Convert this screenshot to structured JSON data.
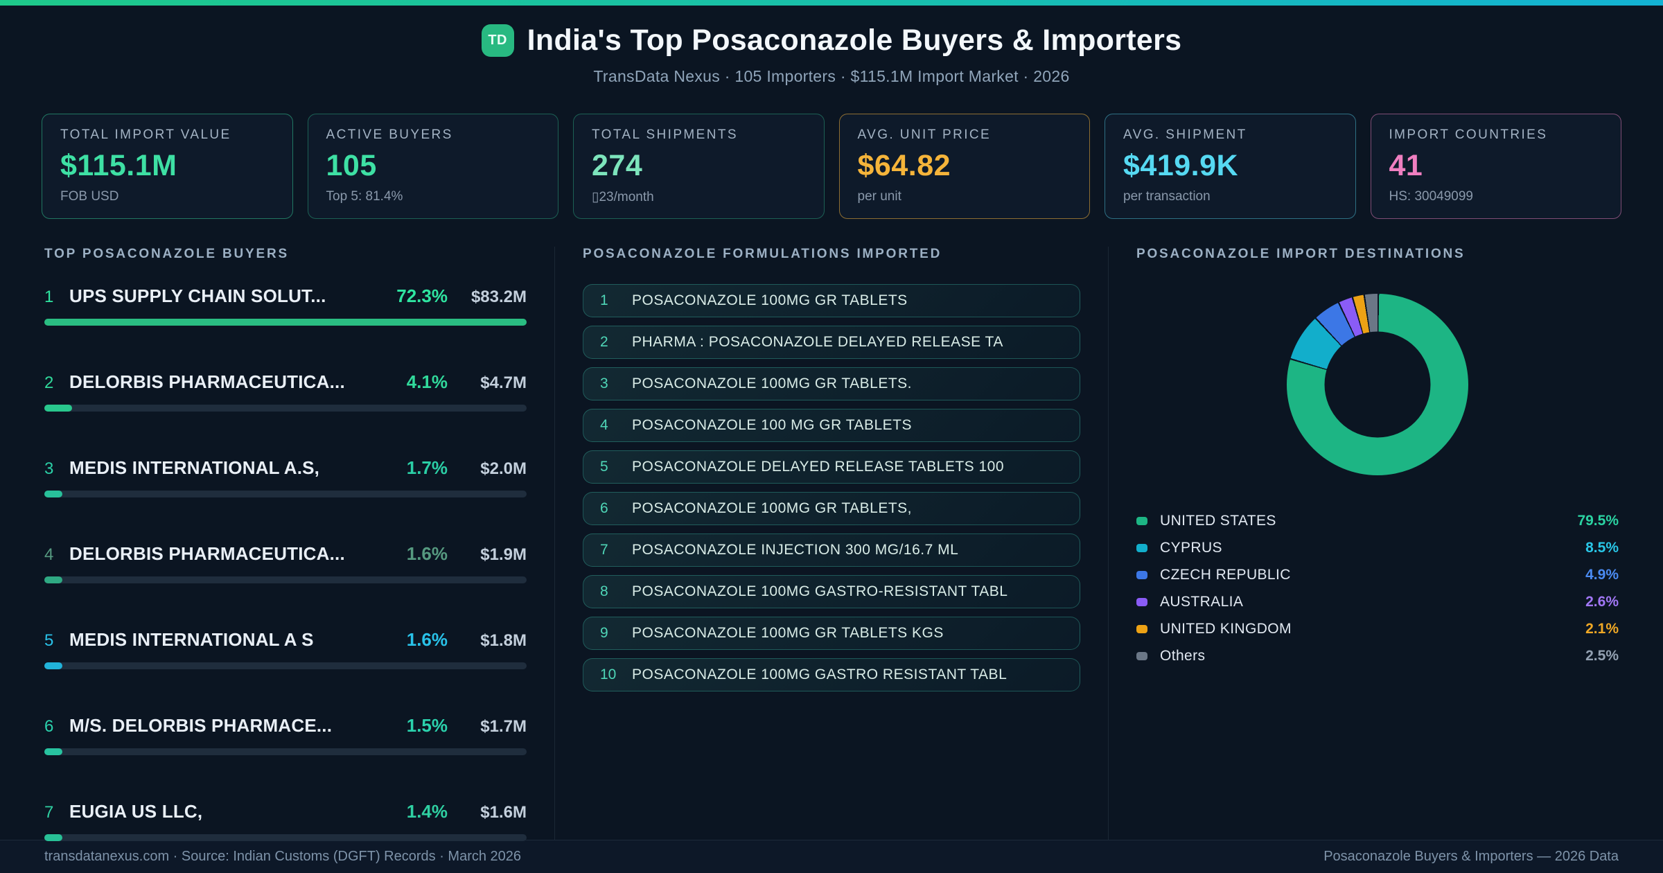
{
  "header": {
    "badge": "TD",
    "title": "India's Top Posaconazole Buyers & Importers",
    "subtitle": "TransData Nexus · 105 Importers · $115.1M Import Market · 2026"
  },
  "stats": [
    {
      "label": "TOTAL IMPORT VALUE",
      "value": "$115.1M",
      "sub": "FOB USD",
      "value_color": "#3ee0a4",
      "border_color": "rgba(52,211,153,0.5)"
    },
    {
      "label": "ACTIVE BUYERS",
      "value": "105",
      "sub": "Top 5: 81.4%",
      "value_color": "#3ee0a4",
      "border_color": "rgba(52,211,153,0.38)"
    },
    {
      "label": "TOTAL SHIPMENTS",
      "value": "274",
      "sub": "▯23/month",
      "value_color": "#7de4bc",
      "border_color": "rgba(52,211,153,0.38)"
    },
    {
      "label": "AVG. UNIT PRICE",
      "value": "$64.82",
      "sub": "per unit",
      "value_color": "#f5b43a",
      "border_color": "rgba(245,180,58,0.55)"
    },
    {
      "label": "AVG. SHIPMENT",
      "value": "$419.9K",
      "sub": "per transaction",
      "value_color": "#56d9f2",
      "border_color": "rgba(86,217,242,0.45)"
    },
    {
      "label": "IMPORT COUNTRIES",
      "value": "41",
      "sub": "HS: 30049099",
      "value_color": "#ef7fc0",
      "border_color": "rgba(239,127,192,0.5)"
    }
  ],
  "buyers": {
    "heading": "TOP POSACONAZOLE BUYERS",
    "items": [
      {
        "rank": "1",
        "name": "UPS SUPPLY CHAIN SOLUT...",
        "pct": "72.3%",
        "value": "$83.2M",
        "accent": "#2fe5a1",
        "bar_color": "#2abd82",
        "bar_width_pct": 100
      },
      {
        "rank": "2",
        "name": "DELORBIS PHARMACEUTICA...",
        "pct": "4.1%",
        "value": "$4.7M",
        "accent": "#31d99b",
        "bar_color": "#29c78d",
        "bar_width_pct": 5.7
      },
      {
        "rank": "3",
        "name": "MEDIS INTERNATIONAL A.S,",
        "pct": "1.7%",
        "value": "$2.0M",
        "accent": "#2bcfa6",
        "bar_color": "#28c09a",
        "bar_width_pct": 2.4
      },
      {
        "rank": "4",
        "name": "DELORBIS PHARMACEUTICA...",
        "pct": "1.6%",
        "value": "$1.9M",
        "accent": "#569a80",
        "bar_color": "#2fa983",
        "bar_width_pct": 2.3
      },
      {
        "rank": "5",
        "name": "MEDIS INTERNATIONAL A S",
        "pct": "1.6%",
        "value": "$1.8M",
        "accent": "#29c2e9",
        "bar_color": "#21b3da",
        "bar_width_pct": 2.3
      },
      {
        "rank": "6",
        "name": "M/S. DELORBIS PHARMACE...",
        "pct": "1.5%",
        "value": "$1.7M",
        "accent": "#2bd2ad",
        "bar_color": "#28c3a0",
        "bar_width_pct": 2.1
      },
      {
        "rank": "7",
        "name": "EUGIA US LLC,",
        "pct": "1.4%",
        "value": "$1.6M",
        "accent": "#2fd0a2",
        "bar_color": "#28c096",
        "bar_width_pct": 2.0
      }
    ]
  },
  "formulations": {
    "heading": "POSACONAZOLE FORMULATIONS IMPORTED",
    "items": [
      {
        "n": "1",
        "name": "POSACONAZOLE 100MG GR TABLETS"
      },
      {
        "n": "2",
        "name": "PHARMA : POSACONAZOLE DELAYED RELEASE TA"
      },
      {
        "n": "3",
        "name": "POSACONAZOLE 100MG GR TABLETS."
      },
      {
        "n": "4",
        "name": "POSACONAZOLE 100 MG GR TABLETS"
      },
      {
        "n": "5",
        "name": "POSACONAZOLE DELAYED RELEASE TABLETS 100"
      },
      {
        "n": "6",
        "name": "POSACONAZOLE 100MG GR TABLETS,"
      },
      {
        "n": "7",
        "name": "POSACONAZOLE INJECTION 300 MG/16.7 ML"
      },
      {
        "n": "8",
        "name": "POSACONAZOLE 100MG GASTRO-RESISTANT TABL"
      },
      {
        "n": "9",
        "name": "POSACONAZOLE 100MG GR TABLETS KGS"
      },
      {
        "n": "10",
        "name": "POSACONAZOLE 100MG GASTRO RESISTANT TABL"
      }
    ]
  },
  "destinations": {
    "heading": "POSACONAZOLE IMPORT DESTINATIONS"
  },
  "chart_data": {
    "type": "pie",
    "donut": true,
    "title": "POSACONAZOLE IMPORT DESTINATIONS",
    "labels": [
      "UNITED STATES",
      "CYPRUS",
      "CZECH REPUBLIC",
      "AUSTRALIA",
      "UNITED KINGDOM",
      "Others"
    ],
    "values": [
      79.5,
      8.5,
      4.9,
      2.6,
      2.1,
      2.5
    ],
    "display_values": [
      "79.5%",
      "8.5%",
      "4.9%",
      "2.6%",
      "2.1%",
      "2.5%"
    ],
    "unit": "%",
    "colors": [
      "#1db584",
      "#12aecb",
      "#3c77e6",
      "#8a5cf6",
      "#eda215",
      "#6b7787"
    ],
    "pct_label_colors": [
      "#2bd3a2",
      "#29c6e6",
      "#4b8bf2",
      "#a177f5",
      "#f0a825",
      "#93a1b2"
    ],
    "start_angle_deg": 0,
    "clockwise": true,
    "legend_position": "bottom",
    "hole_ratio": 0.58
  },
  "footer": {
    "left": "transdatanexus.com · Source: Indian Customs (DGFT) Records · March 2026",
    "right": "Posaconazole Buyers & Importers — 2026 Data"
  }
}
